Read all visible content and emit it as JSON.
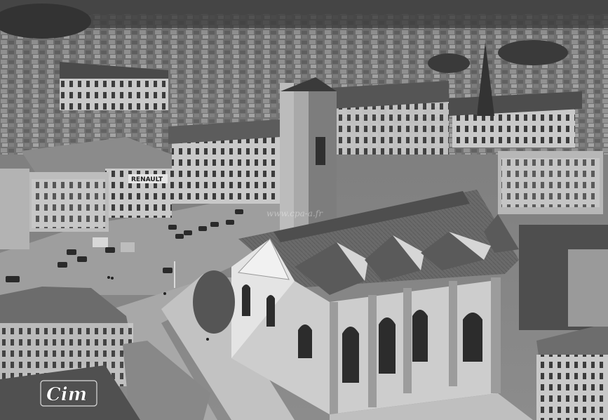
{
  "photo": {
    "sign_label": "RENAULT",
    "watermark": "www.cpa-a.fr",
    "logo_text": "Cim"
  }
}
